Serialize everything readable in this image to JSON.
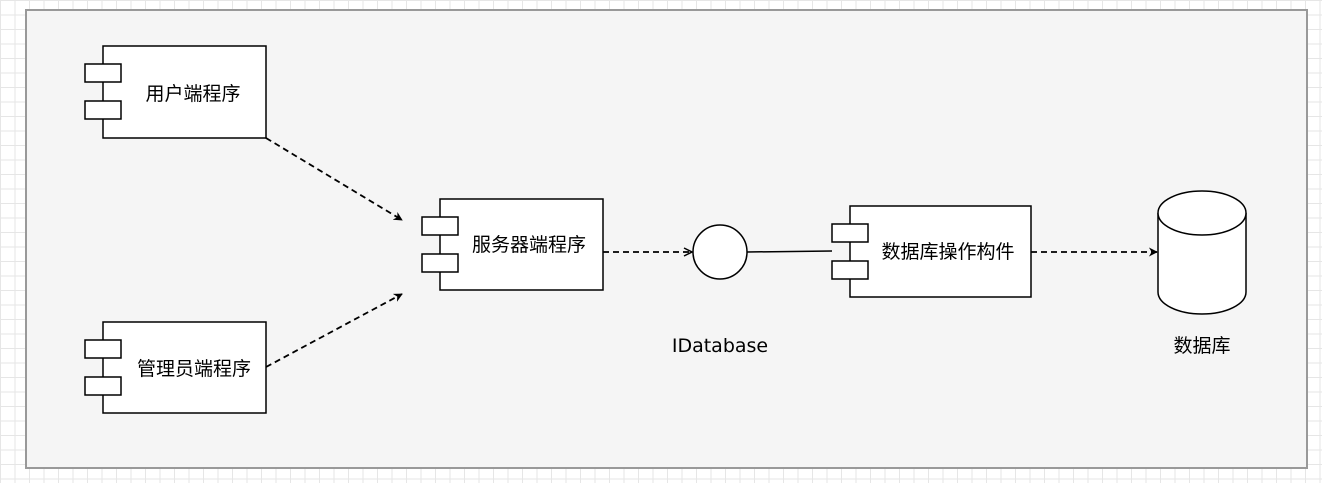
{
  "diagram": {
    "components": {
      "client": "用户端程序",
      "admin": "管理员端程序",
      "server": "服务器端程序",
      "db_component": "数据库操作构件"
    },
    "interface": {
      "label": "IDatabase"
    },
    "database": {
      "label": "数据库"
    },
    "colors": {
      "background": "#f5f5f5",
      "stroke": "#000000",
      "fill": "#ffffff"
    }
  }
}
